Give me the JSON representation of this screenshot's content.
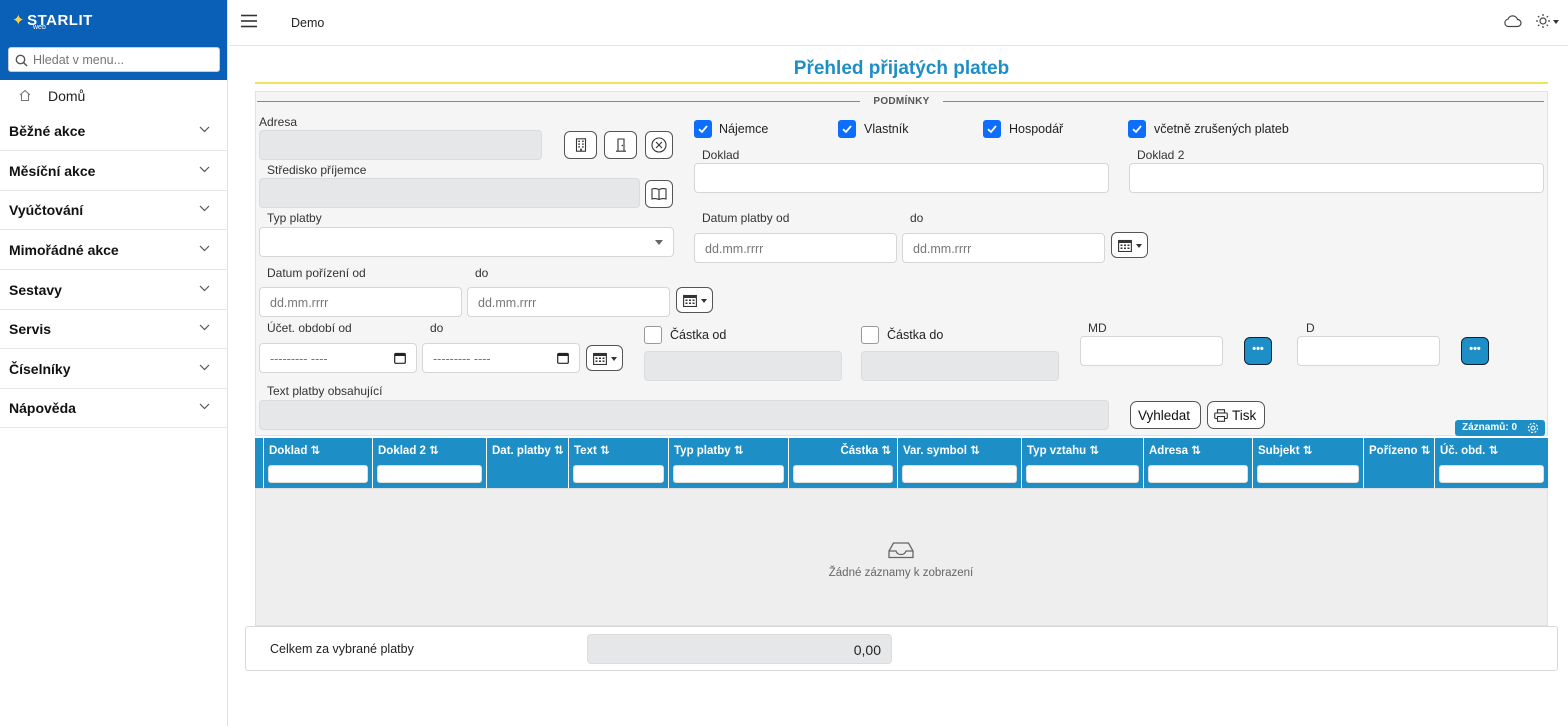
{
  "brand": {
    "name": "STARLIT",
    "sub": "web"
  },
  "search": {
    "placeholder": "Hledat v menu..."
  },
  "sidebar": {
    "home": "Domů",
    "items": [
      {
        "label": "Běžné akce"
      },
      {
        "label": "Měsíční akce"
      },
      {
        "label": "Vyúčtování"
      },
      {
        "label": "Mimořádné akce"
      },
      {
        "label": "Sestavy"
      },
      {
        "label": "Servis"
      },
      {
        "label": "Číselníky"
      },
      {
        "label": "Nápověda"
      }
    ]
  },
  "topbar": {
    "title": "Demo"
  },
  "page": {
    "title": "Přehled přijatých plateb",
    "legend": "PODMÍNKY"
  },
  "form": {
    "adresa": "Adresa",
    "stredisko": "Středisko příjemce",
    "typ_platby": "Typ platby",
    "datum_porizeni_od": "Datum pořízení od",
    "do": "do",
    "ucet_obdobi_od": "Účet. období od",
    "text_platby": "Text platby obsahující",
    "doklad": "Doklad",
    "doklad2": "Doklad 2",
    "datum_platby_od": "Datum platby od",
    "castka_od": "Částka od",
    "castka_do": "Částka do",
    "md": "MD",
    "d": "D",
    "date_placeholder": "dd.mm.rrrr",
    "month_placeholder": "--------- ----",
    "checkboxes": {
      "najemce": "Nájemce",
      "vlastnik": "Vlastník",
      "hospodar": "Hospodář",
      "vcetne": "včetně zrušených plateb"
    }
  },
  "buttons": {
    "vyhledat": "Vyhledat",
    "tisk": "Tisk"
  },
  "records": {
    "label": "Záznamů:",
    "count": "0"
  },
  "grid": {
    "columns": [
      "Doklad",
      "Doklad 2",
      "Dat. platby",
      "Text",
      "Typ platby",
      "Částka",
      "Var. symbol",
      "Typ vztahu",
      "Adresa",
      "Subjekt",
      "Pořízeno",
      "Úč. obd."
    ],
    "empty": "Žádné záznamy k zobrazení"
  },
  "total": {
    "label": "Celkem za vybrané platby",
    "value": "0,00"
  },
  "colors": {
    "brand": "#0a5fb6",
    "accent": "#1e8fc6",
    "check": "#0d6efd",
    "title_line": "#f1e35a"
  }
}
